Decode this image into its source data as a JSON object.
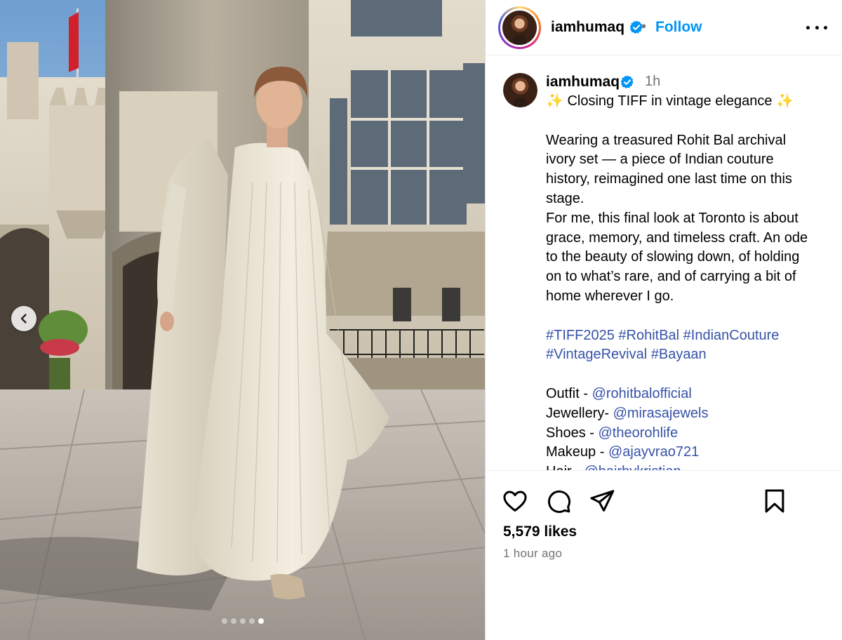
{
  "post": {
    "username": "iamhumaq",
    "follow_label": "Follow",
    "separator": "•",
    "time_short": "1h",
    "likes": "5,579 likes",
    "time_long": "1 hour ago",
    "carousel": {
      "total": 5,
      "current": 5
    }
  },
  "caption": {
    "line1": "✨ Closing TIFF in vintage elegance ✨",
    "para1": [
      "Wearing a treasured Rohit Bal archival",
      "ivory set — a piece of Indian couture",
      "history, reimagined one last time on this",
      "stage.",
      "For me, this final look at Toronto is about",
      "grace, memory, and timeless craft. An ode",
      "to the beauty of slowing down, of holding",
      "on to what’s rare, and of carrying a bit of",
      "home wherever I go."
    ],
    "hashtags_line1": "#TIFF2025 #RohitBal #IndianCouture",
    "hashtags_line2": "#VintageRevival #Bayaan",
    "credits": [
      {
        "label": "Outfit - ",
        "handle": "@rohitbalofficial"
      },
      {
        "label": "Jewellery- ",
        "handle": "@mirasajewels"
      },
      {
        "label": "Shoes - ",
        "handle": "@theorohlife"
      },
      {
        "label": "Makeup - ",
        "handle": "@ajayvrao721"
      },
      {
        "label": "Hair - ",
        "handle": "@hairbykristian"
      }
    ]
  },
  "icons": {
    "verified": "verified-badge-icon",
    "more": "more-options-icon",
    "like": "heart-icon",
    "comment": "comment-icon",
    "share": "share-paper-plane-icon",
    "save": "bookmark-icon",
    "prev": "chevron-left-icon"
  },
  "colors": {
    "link_blue": "#0095f6",
    "hashtag_blue": "#3753a8",
    "muted": "#737373",
    "verified": "#0095f6"
  }
}
